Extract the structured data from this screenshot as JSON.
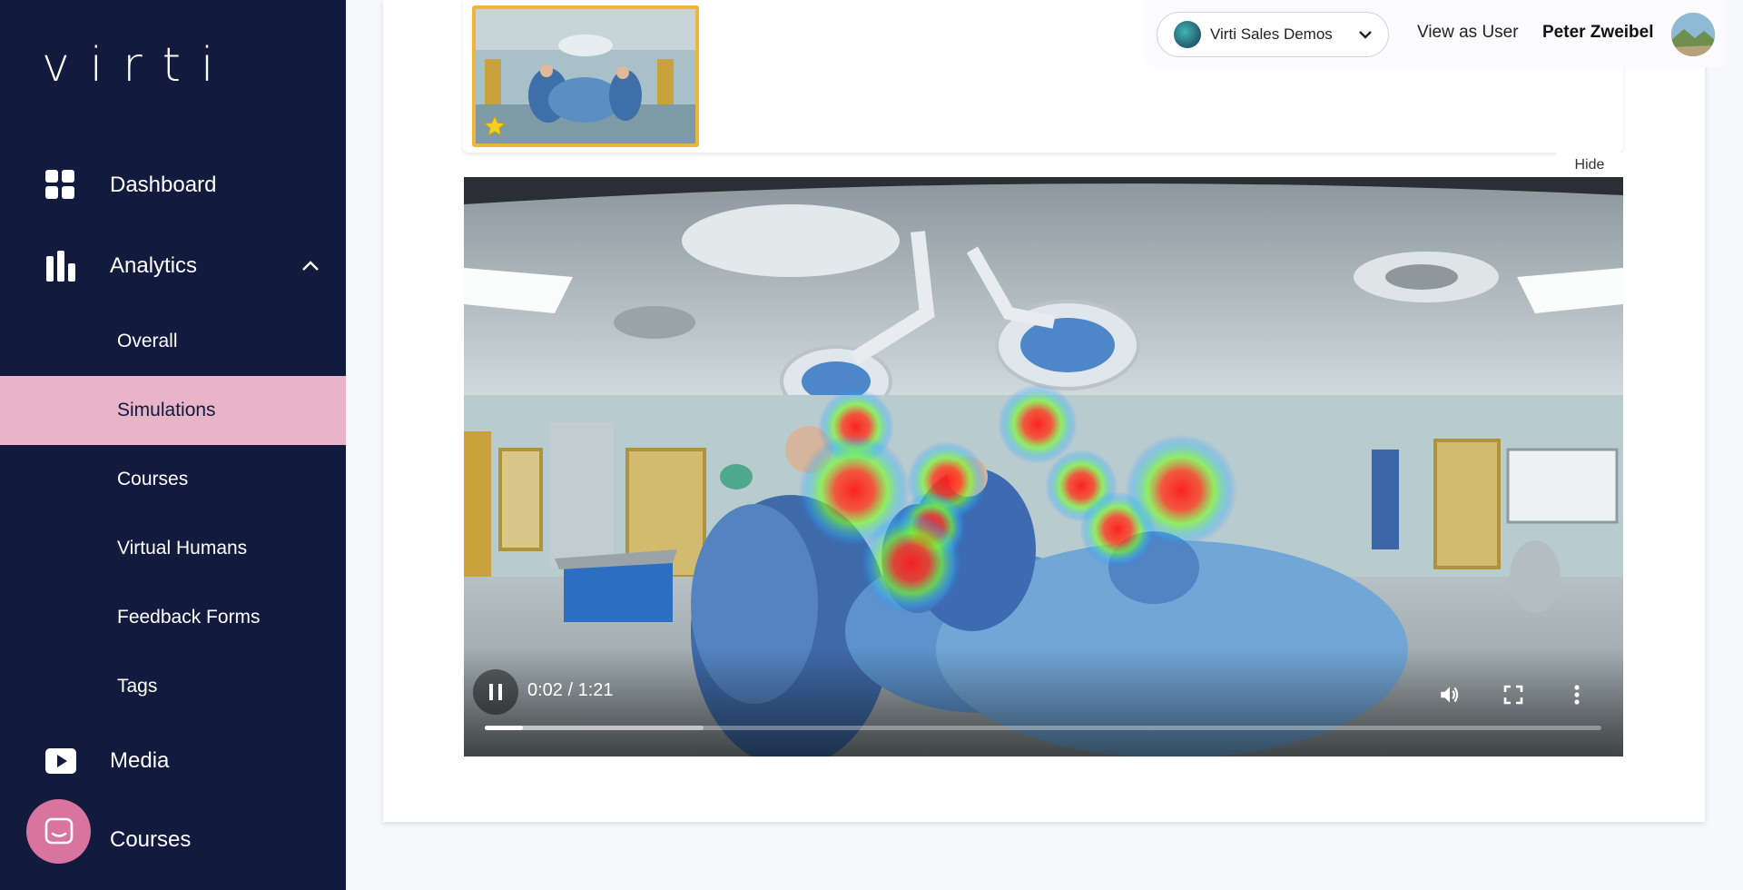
{
  "sidebar": {
    "logo": "virti",
    "items": {
      "dashboard": {
        "label": "Dashboard",
        "icon": "dashboard-icon"
      },
      "analytics": {
        "label": "Analytics",
        "icon": "bar-chart-icon",
        "expanded": true
      },
      "media": {
        "label": "Media",
        "icon": "play-icon"
      },
      "courses": {
        "label": "Courses",
        "icon": "courses-icon"
      }
    },
    "analytics_sub": {
      "overall": "Overall",
      "simulations": "Simulations",
      "courses": "Courses",
      "virtual_humans": "Virtual Humans",
      "feedback_forms": "Feedback Forms",
      "tags": "Tags"
    },
    "active_item": "Simulations",
    "active_color": "#e8b4c8",
    "bg_color": "#121a3e"
  },
  "header": {
    "org_select": "Virti Sales Demos",
    "view_as": "View as User",
    "user_name": "Peter Zweibel"
  },
  "thumbnails": {
    "hide_label": "Hide",
    "selected_border_color": "#f0b43c",
    "favorite_icon": "star-icon"
  },
  "video": {
    "time": "0:02 / 1:21",
    "played_fraction": 0.034,
    "buffered_fraction": 0.196,
    "state": "playing"
  }
}
